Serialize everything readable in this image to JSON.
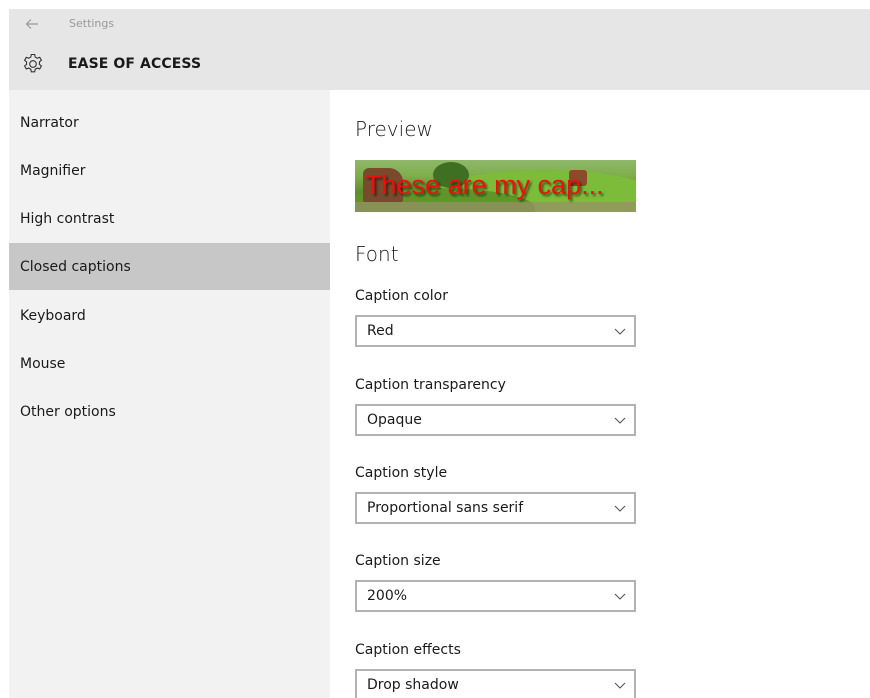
{
  "titlebar": {
    "back_icon": "back-arrow-icon",
    "title": "Settings"
  },
  "header": {
    "icon": "gear-icon",
    "title": "EASE OF ACCESS"
  },
  "sidebar": {
    "items": [
      {
        "label": "Narrator",
        "selected": false
      },
      {
        "label": "Magnifier",
        "selected": false
      },
      {
        "label": "High contrast",
        "selected": false
      },
      {
        "label": "Closed captions",
        "selected": true
      },
      {
        "label": "Keyboard",
        "selected": false
      },
      {
        "label": "Mouse",
        "selected": false
      },
      {
        "label": "Other options",
        "selected": false
      }
    ],
    "selected_bg": "#c7c7c7"
  },
  "content": {
    "preview_title": "Preview",
    "preview_caption": "These are my cap...",
    "caption_color_hex": "#e8120c",
    "font_title": "Font",
    "fields": [
      {
        "label": "Caption color",
        "value": "Red"
      },
      {
        "label": "Caption transparency",
        "value": "Opaque"
      },
      {
        "label": "Caption style",
        "value": "Proportional sans serif"
      },
      {
        "label": "Caption size",
        "value": "200%"
      },
      {
        "label": "Caption effects",
        "value": "Drop shadow"
      }
    ]
  }
}
